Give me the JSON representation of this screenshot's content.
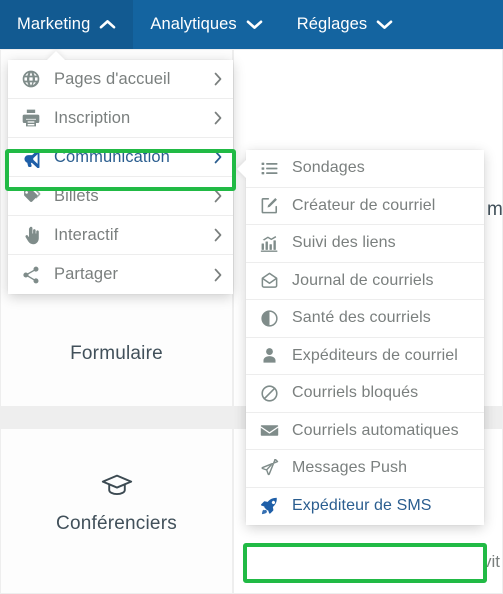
{
  "topnav": {
    "background_color": "#1464a0",
    "active_background_color": "#125a91",
    "items": [
      {
        "label": "Marketing",
        "caret": "chevron-up-icon",
        "active": true
      },
      {
        "label": "Analytiques",
        "caret": "chevron-down-icon",
        "active": false
      },
      {
        "label": "Réglages",
        "caret": "chevron-down-icon",
        "active": false
      }
    ]
  },
  "highlight_color": "#21ba45",
  "menu_marketing": {
    "items": [
      {
        "label": "Pages d'accueil",
        "icon": "globe-icon",
        "arrow": "chevron-right-icon",
        "highlighted": false
      },
      {
        "label": "Inscription",
        "icon": "printer-icon",
        "arrow": "chevron-right-icon",
        "highlighted": false
      },
      {
        "label": "Communication",
        "icon": "megaphone-icon",
        "arrow": "chevron-right-icon",
        "highlighted": true
      },
      {
        "label": "Billets",
        "icon": "tags-icon",
        "arrow": "chevron-right-icon",
        "highlighted": false
      },
      {
        "label": "Interactif",
        "icon": "hand-pointer-icon",
        "arrow": "chevron-right-icon",
        "highlighted": false
      },
      {
        "label": "Partager",
        "icon": "share-icon",
        "arrow": "chevron-right-icon",
        "highlighted": false
      }
    ]
  },
  "menu_communication": {
    "items": [
      {
        "label": "Sondages",
        "icon": "list-icon",
        "highlighted": false
      },
      {
        "label": "Créateur de courriel",
        "icon": "edit-square-icon",
        "highlighted": false
      },
      {
        "label": "Suivi des liens",
        "icon": "bar-chart-icon",
        "highlighted": false
      },
      {
        "label": "Journal de courriels",
        "icon": "open-envelope-icon",
        "highlighted": false
      },
      {
        "label": "Santé des courriels",
        "icon": "contrast-circle-icon",
        "highlighted": false
      },
      {
        "label": "Expéditeurs de courriel",
        "icon": "user-icon",
        "highlighted": false
      },
      {
        "label": "Courriels bloqués",
        "icon": "ban-icon",
        "highlighted": false
      },
      {
        "label": "Courriels automatiques",
        "icon": "envelope-icon",
        "highlighted": false
      },
      {
        "label": "Messages Push",
        "icon": "paper-plane-icon",
        "highlighted": false
      },
      {
        "label": "Expéditeur de SMS",
        "icon": "rocket-icon",
        "highlighted": true
      }
    ]
  },
  "background": {
    "tiles": [
      {
        "label": "Formulaire",
        "icon": ""
      },
      {
        "label": "Conférenciers",
        "icon": "graduation-cap-icon"
      }
    ],
    "clipped_texts": [
      {
        "text": "me"
      },
      {
        "text": "vit"
      }
    ]
  }
}
